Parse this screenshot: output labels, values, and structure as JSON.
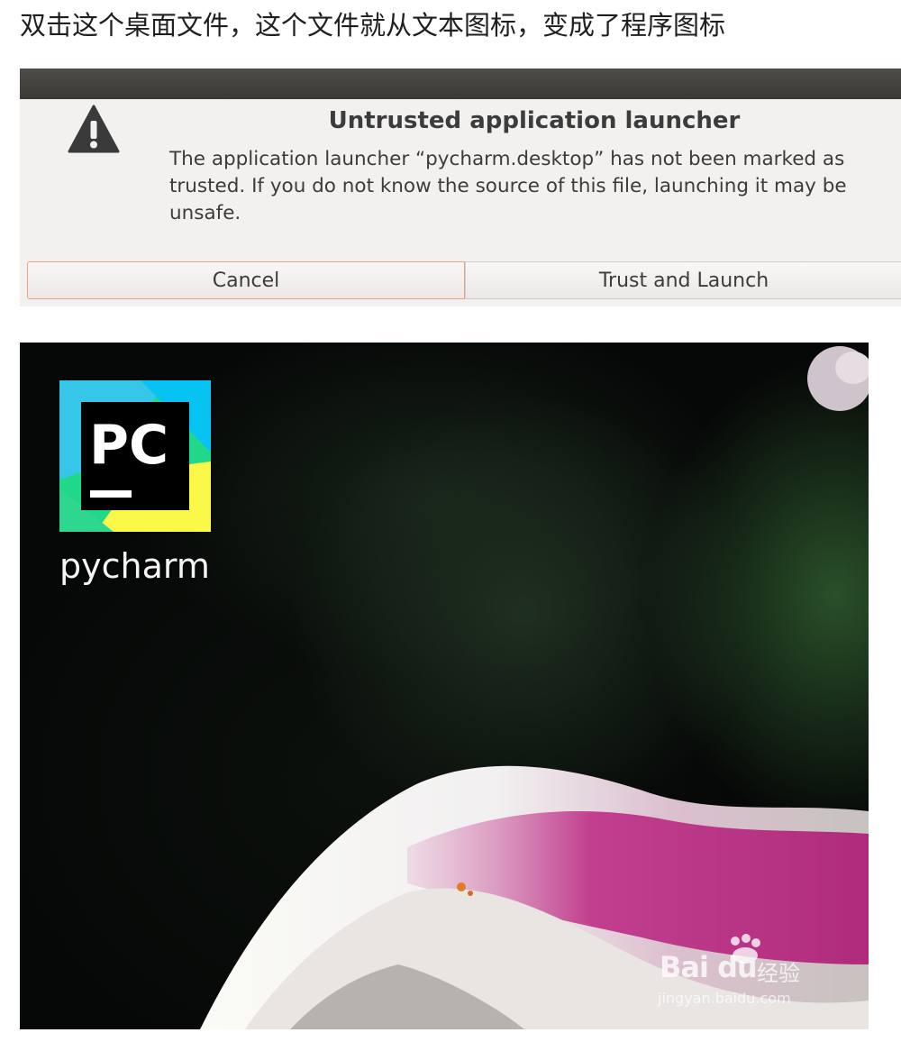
{
  "caption": "双击这个桌面文件，这个文件就从文本图标，变成了程序图标",
  "dialog": {
    "title": "Untrusted application launcher",
    "message": "The application launcher “pycharm.desktop” has not been marked as trusted. If you do not know the source of this file, launching it may be unsafe.",
    "buttons": {
      "cancel": "Cancel",
      "trust": "Trust and Launch"
    },
    "icon": "warning-icon"
  },
  "desktop": {
    "app_icon": {
      "name": "pycharm-icon",
      "badge_text": "PC",
      "colors": [
        "#21d789",
        "#fcf84a",
        "#07c3f2",
        "#000000"
      ]
    },
    "app_label": "pycharm",
    "watermark": {
      "brand": "Bai du",
      "brand_cn": "经验",
      "url": "jingyan.baidu.com"
    }
  }
}
